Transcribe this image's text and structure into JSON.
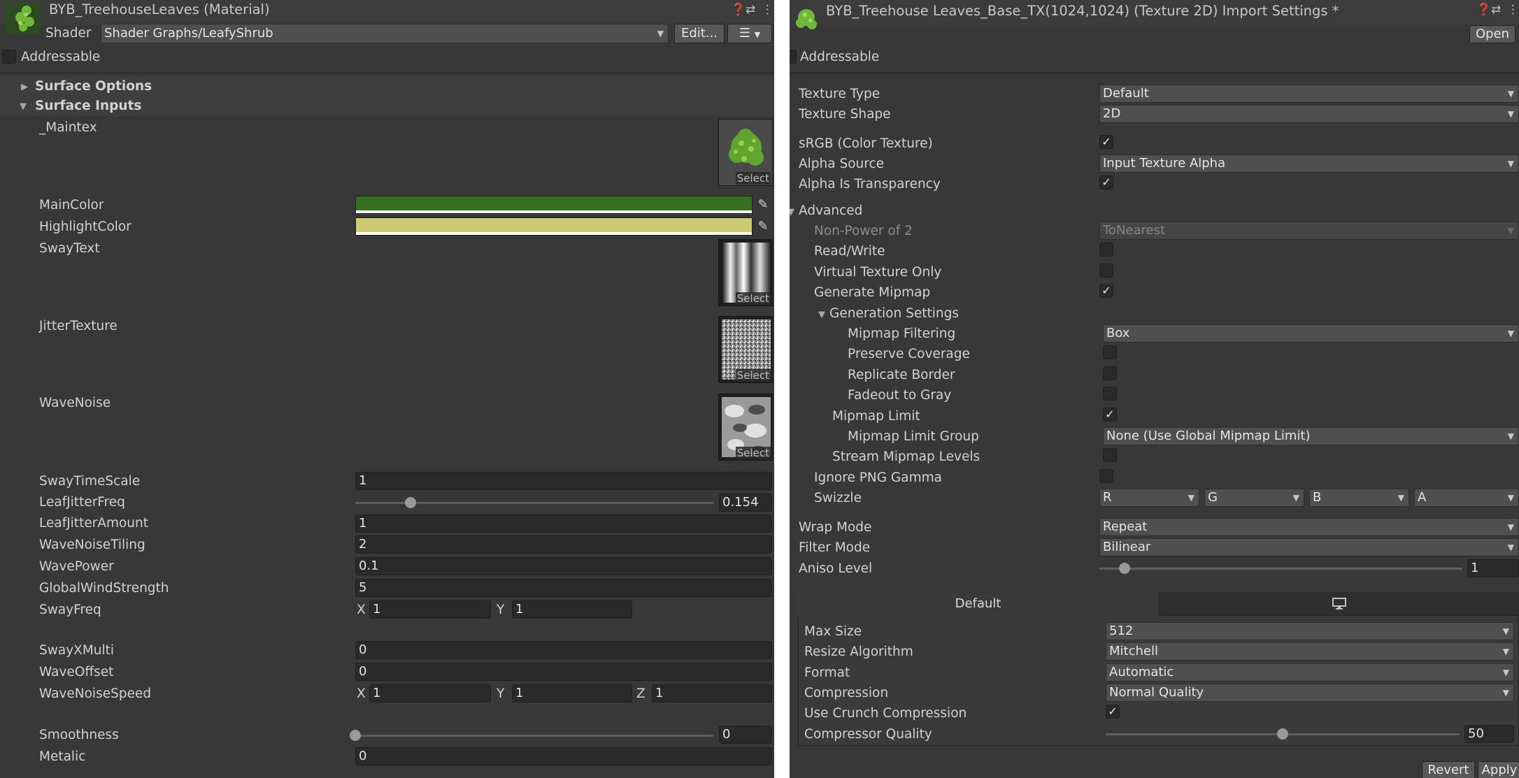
{
  "material": {
    "title": "BYB_TreehouseLeaves (Material)",
    "shader_label": "Shader",
    "shader_value": "Shader Graphs/LeafyShrub",
    "edit_label": "Edit...",
    "addressable_label": "Addressable",
    "sections": {
      "surface_options": "Surface Options",
      "surface_inputs": "Surface Inputs"
    },
    "textures": {
      "maintex": "_Maintex",
      "swaytext": "SwayText",
      "jitter": "JitterTexture",
      "wavenoise": "WaveNoise",
      "select_label": "Select"
    },
    "colors": {
      "main_label": "MainColor",
      "main_hex": "#34701f",
      "highlight_label": "HighlightColor",
      "highlight_hex": "#cdcb72"
    },
    "fields": {
      "sway_time_scale": {
        "label": "SwayTimeScale",
        "value": "1"
      },
      "leaf_jitter_freq": {
        "label": "LeafJitterFreq",
        "value": "0.154",
        "fraction": 0.154
      },
      "leaf_jitter_amount": {
        "label": "LeafJitterAmount",
        "value": "1"
      },
      "wave_noise_tiling": {
        "label": "WaveNoiseTiling",
        "value": "2"
      },
      "wave_power": {
        "label": "WavePower",
        "value": "0.1"
      },
      "global_wind_strength": {
        "label": "GlobalWindStrength",
        "value": "5"
      },
      "sway_freq": {
        "label": "SwayFreq",
        "x_label": "X",
        "x": "1",
        "y_label": "Y",
        "y": "1"
      },
      "sway_x_multi": {
        "label": "SwayXMulti",
        "value": "0"
      },
      "wave_offset": {
        "label": "WaveOffset",
        "value": "0"
      },
      "wave_noise_speed": {
        "label": "WaveNoiseSpeed",
        "x_label": "X",
        "x": "1",
        "y_label": "Y",
        "y": "1",
        "z_label": "Z",
        "z": "1"
      },
      "smoothness": {
        "label": "Smoothness",
        "value": "0",
        "fraction": 0
      },
      "metalic": {
        "label": "Metalic",
        "value": "0"
      }
    }
  },
  "importer": {
    "title": "BYB_Treehouse Leaves_Base_TX(1024,1024) (Texture 2D) Import Settings *",
    "open_label": "Open",
    "addressable_label": "Addressable",
    "texture_type": {
      "label": "Texture Type",
      "value": "Default"
    },
    "texture_shape": {
      "label": "Texture Shape",
      "value": "2D"
    },
    "srgb": {
      "label": "sRGB (Color Texture)",
      "checked": true
    },
    "alpha_source": {
      "label": "Alpha Source",
      "value": "Input Texture Alpha"
    },
    "alpha_is_transparency": {
      "label": "Alpha Is Transparency",
      "checked": true
    },
    "advanced": {
      "label": "Advanced",
      "non_power_of_2": {
        "label": "Non-Power of 2",
        "value": "ToNearest"
      },
      "read_write": {
        "label": "Read/Write",
        "checked": false
      },
      "virtual_texture_only": {
        "label": "Virtual Texture Only",
        "checked": false
      },
      "generate_mipmap": {
        "label": "Generate Mipmap",
        "checked": true
      },
      "generation_settings": "Generation Settings",
      "mipmap_filtering": {
        "label": "Mipmap Filtering",
        "value": "Box"
      },
      "preserve_coverage": {
        "label": "Preserve Coverage",
        "checked": false
      },
      "replicate_border": {
        "label": "Replicate Border",
        "checked": false
      },
      "fadeout_to_gray": {
        "label": "Fadeout to Gray",
        "checked": false
      },
      "mipmap_limit": {
        "label": "Mipmap Limit",
        "checked": true
      },
      "mipmap_limit_group": {
        "label": "Mipmap Limit Group",
        "value": "None (Use Global Mipmap Limit)"
      },
      "stream_mipmap_levels": {
        "label": "Stream Mipmap Levels",
        "checked": false
      },
      "ignore_png_gamma": {
        "label": "Ignore PNG Gamma",
        "checked": false
      },
      "swizzle": {
        "label": "Swizzle",
        "r": "R",
        "g": "G",
        "b": "B",
        "a": "A"
      }
    },
    "wrap_mode": {
      "label": "Wrap Mode",
      "value": "Repeat"
    },
    "filter_mode": {
      "label": "Filter Mode",
      "value": "Bilinear"
    },
    "aniso_level": {
      "label": "Aniso Level",
      "value": "1",
      "fraction": 0.07
    },
    "platform": {
      "default_tab": "Default",
      "standalone_icon": "monitor-icon",
      "max_size": {
        "label": "Max Size",
        "value": "512"
      },
      "resize_algorithm": {
        "label": "Resize Algorithm",
        "value": "Mitchell"
      },
      "format": {
        "label": "Format",
        "value": "Automatic"
      },
      "compression": {
        "label": "Compression",
        "value": "Normal Quality"
      },
      "use_crunch": {
        "label": "Use Crunch Compression",
        "checked": true
      },
      "compressor_quality": {
        "label": "Compressor Quality",
        "value": "50",
        "fraction": 0.5
      }
    },
    "revert_label": "Revert",
    "apply_label": "Apply"
  }
}
